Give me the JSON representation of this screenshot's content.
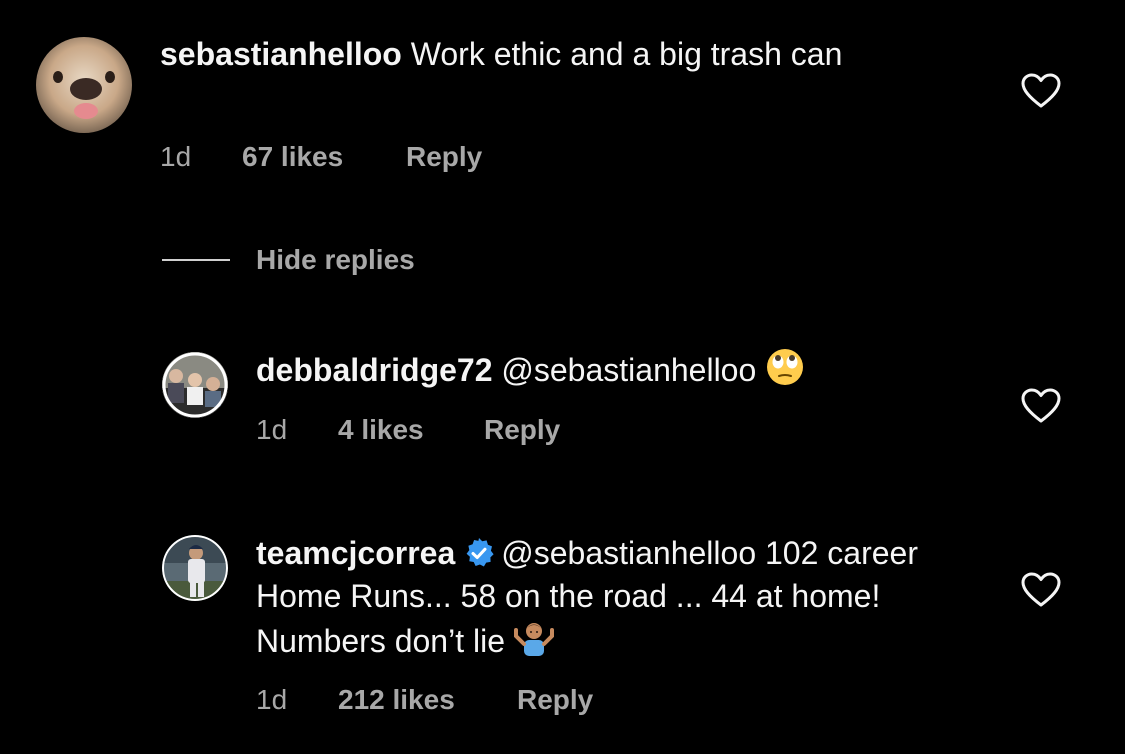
{
  "comments": [
    {
      "username": "sebastianhelloo",
      "text": " Work ethic and a big trash can",
      "time": "1d",
      "likes": "67 likes",
      "reply": "Reply"
    },
    {
      "username": "debbaldridge72",
      "text": " @sebastianhelloo ",
      "emoji": "face-with-rolling-eyes",
      "time": "1d",
      "likes": "4 likes",
      "reply": "Reply"
    },
    {
      "username": "teamcjcorrea",
      "verified": true,
      "text": "@sebastianhelloo 102 career Home Runs... 58 on the road ... 44 at home! Numbers don’t lie ",
      "emoji": "person-shrugging",
      "time": "1d",
      "likes": "212 likes",
      "reply": "Reply"
    }
  ],
  "hide_replies": "Hide replies",
  "icons": {
    "like": "heart-outline-icon",
    "verified": "verified-badge-icon"
  },
  "colors": {
    "background": "#000000",
    "primary_text": "#f5f5f5",
    "secondary_text": "#a8a8a8",
    "verified_blue": "#3897f0"
  }
}
